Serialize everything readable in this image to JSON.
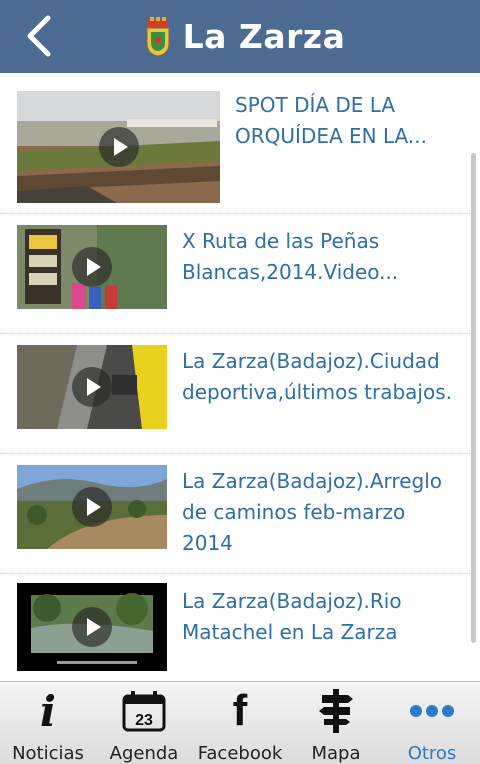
{
  "header": {
    "title": "La Zarza",
    "back_icon": "chevron-left-icon",
    "logo": "coat-of-arms"
  },
  "videos": [
    {
      "title": "SPOT DÍA DE LA ORQUÍDEA EN LA..."
    },
    {
      "title": "X Ruta de las Peñas Blancas,2014.Video..."
    },
    {
      "title": "La Zarza(Badajoz).Ciudad deportiva,últimos trabajos."
    },
    {
      "title": "La Zarza(Badajoz).Arreglo de caminos feb-marzo  2014"
    },
    {
      "title": "La Zarza(Badajoz).Rio Matachel en La Zarza"
    }
  ],
  "tabs": [
    {
      "label": "Noticias",
      "icon": "info-icon"
    },
    {
      "label": "Agenda",
      "icon": "calendar-icon",
      "icon_text": "23"
    },
    {
      "label": "Facebook",
      "icon": "facebook-icon"
    },
    {
      "label": "Mapa",
      "icon": "signpost-icon"
    },
    {
      "label": "Otros",
      "icon": "more-icon",
      "active": true
    }
  ],
  "colors": {
    "header": "#4b6b92",
    "link": "#2d6fa6",
    "active_tab": "#2a7cc7"
  }
}
